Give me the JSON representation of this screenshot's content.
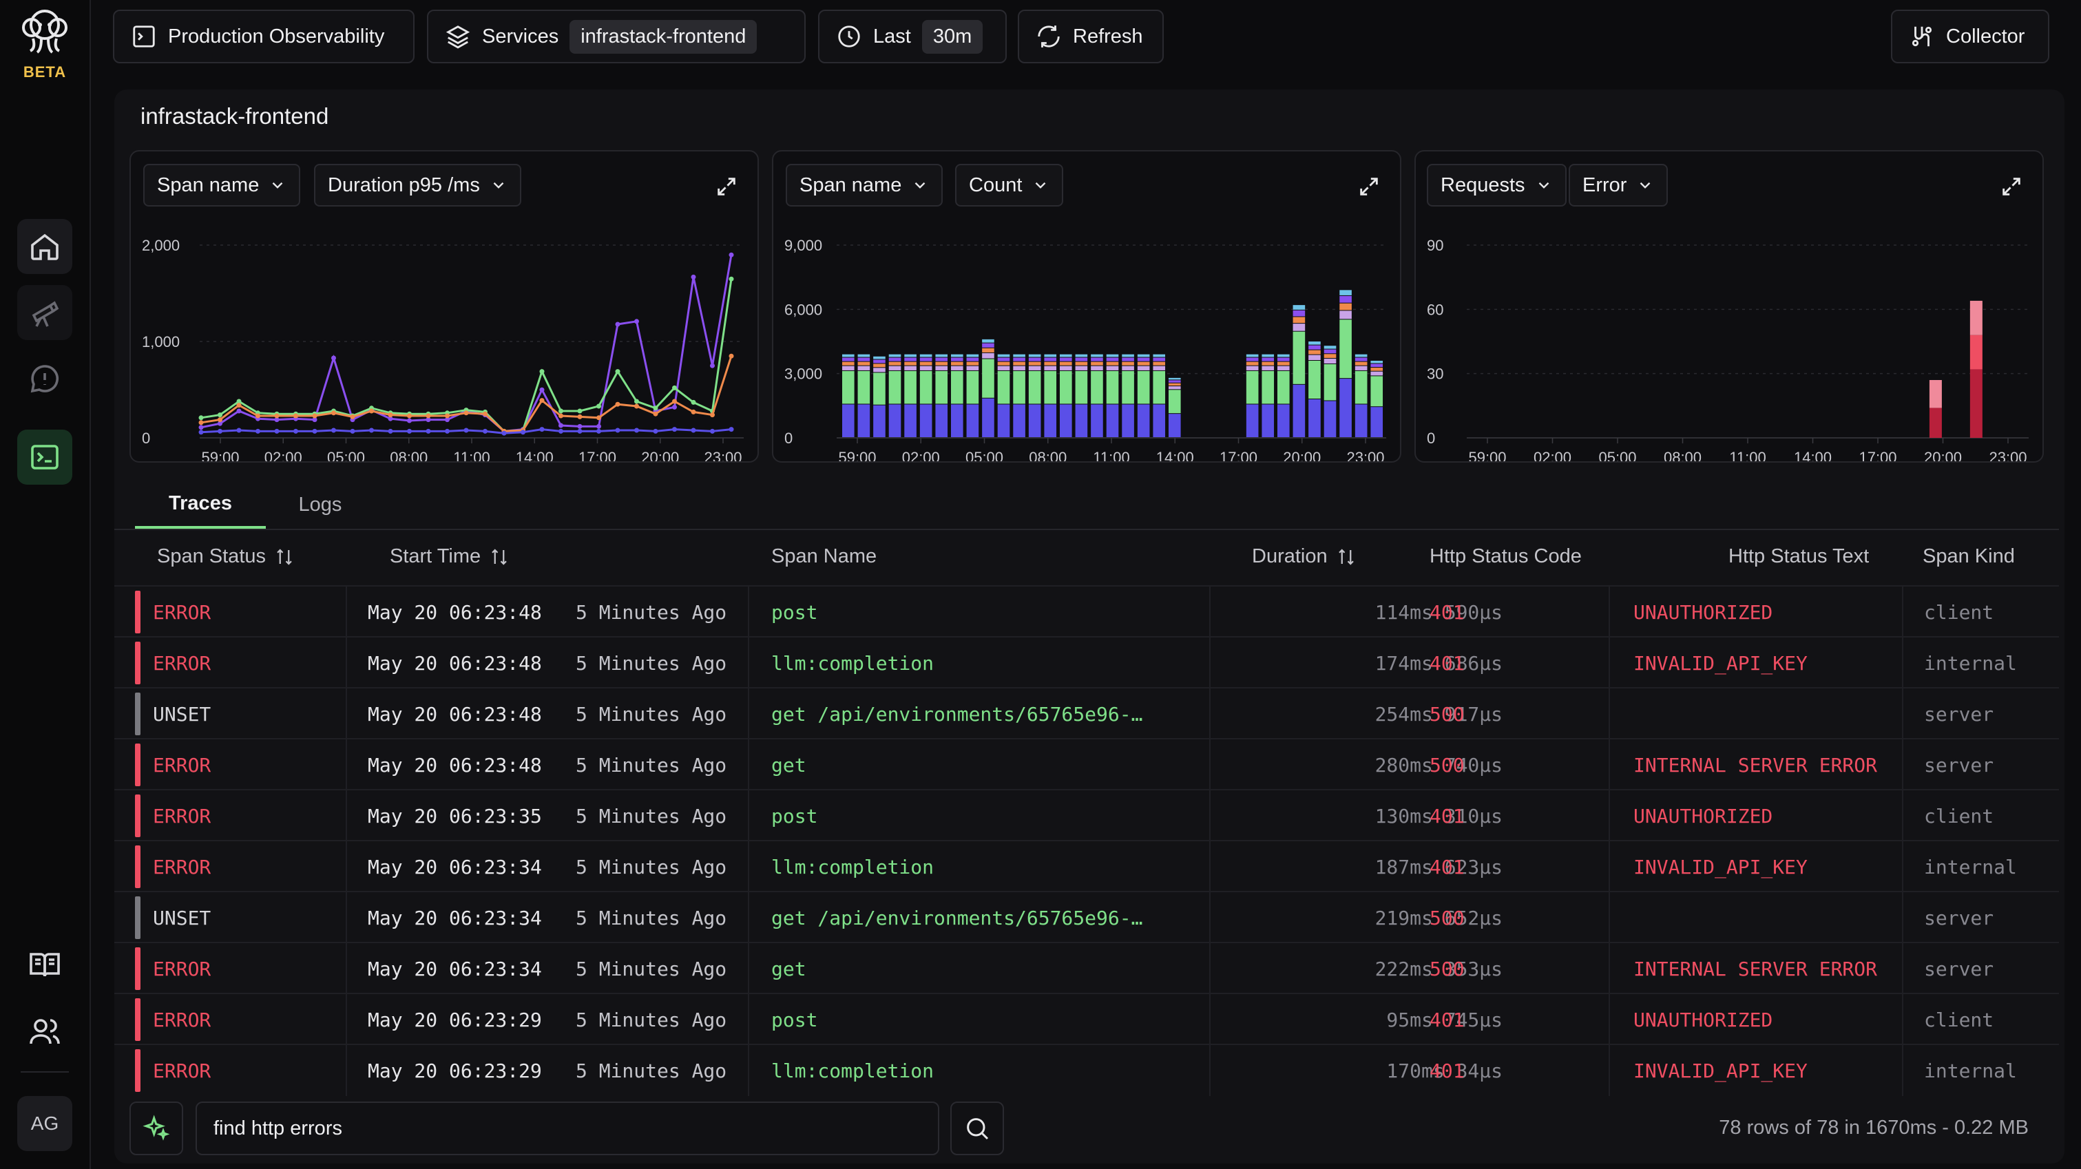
{
  "brand": {
    "badge": "BETA",
    "avatar": "AG"
  },
  "toolbar": {
    "project": "Production Observability",
    "services_label": "Services",
    "service_value": "infrastack-frontend",
    "time_label": "Last",
    "time_value": "30m",
    "refresh": "Refresh",
    "collector": "Collector"
  },
  "page_title": "infrastack-frontend",
  "colors": {
    "accent_green": "#7fe089",
    "error_red": "#ef4e62",
    "purple": "#8a4ff0",
    "blue": "#5a4fe8",
    "orange": "#f08a4b"
  },
  "panels": [
    {
      "dd1": "Span name",
      "dd2": "Duration p95 /ms"
    },
    {
      "dd1": "Span name",
      "dd2": "Count"
    },
    {
      "dd1": "Requests",
      "dd2": "Error"
    }
  ],
  "chart_data": [
    {
      "type": "line",
      "ylim": [
        0,
        2000
      ],
      "yticks": [
        "2,000",
        "1,000",
        "0"
      ],
      "xticks": [
        "59:00",
        "02:00",
        "05:00",
        "08:00",
        "11:00",
        "14:00",
        "17:00",
        "20:00",
        "23:00"
      ],
      "series": [
        {
          "color": "#8a4ff0",
          "values": [
            80,
            120,
            250,
            170,
            160,
            170,
            160,
            800,
            160,
            260,
            170,
            150,
            160,
            160,
            250,
            210,
            40,
            60,
            470,
            100,
            90,
            90,
            1150,
            1180,
            250,
            290,
            1640,
            720,
            1870
          ]
        },
        {
          "color": "#7fe089",
          "values": [
            180,
            210,
            350,
            230,
            220,
            220,
            220,
            250,
            200,
            280,
            230,
            220,
            220,
            230,
            260,
            240,
            40,
            50,
            660,
            250,
            250,
            300,
            660,
            350,
            280,
            490,
            340,
            250,
            1620
          ]
        },
        {
          "color": "#f08a4b",
          "values": [
            130,
            160,
            310,
            200,
            200,
            200,
            200,
            230,
            190,
            250,
            210,
            200,
            200,
            200,
            230,
            220,
            40,
            50,
            360,
            200,
            190,
            180,
            320,
            300,
            220,
            350,
            240,
            210,
            820
          ]
        },
        {
          "color": "#5a4fe8",
          "values": [
            30,
            40,
            50,
            40,
            40,
            40,
            40,
            50,
            40,
            50,
            40,
            40,
            40,
            40,
            50,
            40,
            20,
            30,
            60,
            40,
            40,
            40,
            50,
            50,
            40,
            60,
            50,
            40,
            60
          ]
        }
      ]
    },
    {
      "type": "bar",
      "stacked": true,
      "ylim": [
        0,
        9000
      ],
      "yticks": [
        "9,000",
        "6,000",
        "3,000",
        "0"
      ],
      "xticks": [
        "59:00",
        "02:00",
        "05:00",
        "08:00",
        "11:00",
        "14:00",
        "17:00",
        "20:00",
        "23:00"
      ],
      "totals": [
        3900,
        3900,
        3800,
        3900,
        3900,
        3900,
        3900,
        3900,
        3900,
        4600,
        3900,
        3900,
        3900,
        3900,
        3900,
        3900,
        3900,
        3900,
        3900,
        3900,
        3900,
        2800,
        0,
        0,
        0,
        0,
        3900,
        3900,
        3900,
        6200,
        4500,
        4300,
        6900,
        3900,
        3600
      ],
      "segments": [
        {
          "color": "#5a4fe8",
          "share": 0.4
        },
        {
          "color": "#7fe089",
          "share": 0.4
        },
        {
          "color": "#c9a3e8",
          "share": 0.06
        },
        {
          "color": "#f08a4b",
          "share": 0.05
        },
        {
          "color": "#8a4ff0",
          "share": 0.05
        },
        {
          "color": "#6ec3e8",
          "share": 0.04
        }
      ]
    },
    {
      "type": "bar",
      "stacked": true,
      "ylim": [
        0,
        90
      ],
      "yticks": [
        "90",
        "60",
        "30",
        "0"
      ],
      "xticks": [
        "59:00",
        "02:00",
        "05:00",
        "08:00",
        "11:00",
        "14:00",
        "17:00",
        "20:00",
        "23:00"
      ],
      "bars": [
        {
          "slot": 19.6,
          "segments": [
            {
              "color": "#b8203b",
              "value": 14
            },
            {
              "color": "#f08a9b",
              "value": 13
            }
          ]
        },
        {
          "slot": 21.4,
          "segments": [
            {
              "color": "#b8203b",
              "value": 32
            },
            {
              "color": "#ef4e62",
              "value": 16
            },
            {
              "color": "#f08a9b",
              "value": 16
            }
          ]
        }
      ]
    }
  ],
  "tabs": {
    "traces": "Traces",
    "logs": "Logs"
  },
  "columns": {
    "status": "Span Status",
    "start": "Start Time",
    "name": "Span Name",
    "duration": "Duration",
    "code": "Http Status Code",
    "text": "Http Status Text",
    "kind": "Span Kind"
  },
  "rows": [
    {
      "status": "ERROR",
      "date": "May 20 06:23:48",
      "ago": "5 Minutes Ago",
      "name": "post",
      "duration": "114ms 590µs",
      "code": "401",
      "text": "UNAUTHORIZED",
      "kind": "client"
    },
    {
      "status": "ERROR",
      "date": "May 20 06:23:48",
      "ago": "5 Minutes Ago",
      "name": "llm:completion",
      "duration": "174ms 686µs",
      "code": "401",
      "text": "INVALID_API_KEY",
      "kind": "internal"
    },
    {
      "status": "UNSET",
      "date": "May 20 06:23:48",
      "ago": "5 Minutes Ago",
      "name": "get /api/environments/65765e96-…",
      "duration": "254ms 917µs",
      "code": "500",
      "text": "",
      "kind": "server"
    },
    {
      "status": "ERROR",
      "date": "May 20 06:23:48",
      "ago": "5 Minutes Ago",
      "name": "get",
      "duration": "280ms 740µs",
      "code": "500",
      "text": "INTERNAL SERVER ERROR",
      "kind": "server"
    },
    {
      "status": "ERROR",
      "date": "May 20 06:23:35",
      "ago": "5 Minutes Ago",
      "name": "post",
      "duration": "130ms 310µs",
      "code": "401",
      "text": "UNAUTHORIZED",
      "kind": "client"
    },
    {
      "status": "ERROR",
      "date": "May 20 06:23:34",
      "ago": "5 Minutes Ago",
      "name": "llm:completion",
      "duration": "187ms 623µs",
      "code": "401",
      "text": "INVALID_API_KEY",
      "kind": "internal"
    },
    {
      "status": "UNSET",
      "date": "May 20 06:23:34",
      "ago": "5 Minutes Ago",
      "name": "get /api/environments/65765e96-…",
      "duration": "219ms 652µs",
      "code": "500",
      "text": "",
      "kind": "server"
    },
    {
      "status": "ERROR",
      "date": "May 20 06:23:34",
      "ago": "5 Minutes Ago",
      "name": "get",
      "duration": "222ms 353µs",
      "code": "500",
      "text": "INTERNAL SERVER ERROR",
      "kind": "server"
    },
    {
      "status": "ERROR",
      "date": "May 20 06:23:29",
      "ago": "5 Minutes Ago",
      "name": "post",
      "duration": "95ms 745µs",
      "code": "401",
      "text": "UNAUTHORIZED",
      "kind": "client"
    },
    {
      "status": "ERROR",
      "date": "May 20 06:23:29",
      "ago": "5 Minutes Ago",
      "name": "llm:completion",
      "duration": "170ms 34µs",
      "code": "401",
      "text": "INVALID_API_KEY",
      "kind": "internal"
    }
  ],
  "query": {
    "value": "find http errors"
  },
  "footer": {
    "stats": "78 rows of 78 in 1670ms - 0.22 MB"
  }
}
